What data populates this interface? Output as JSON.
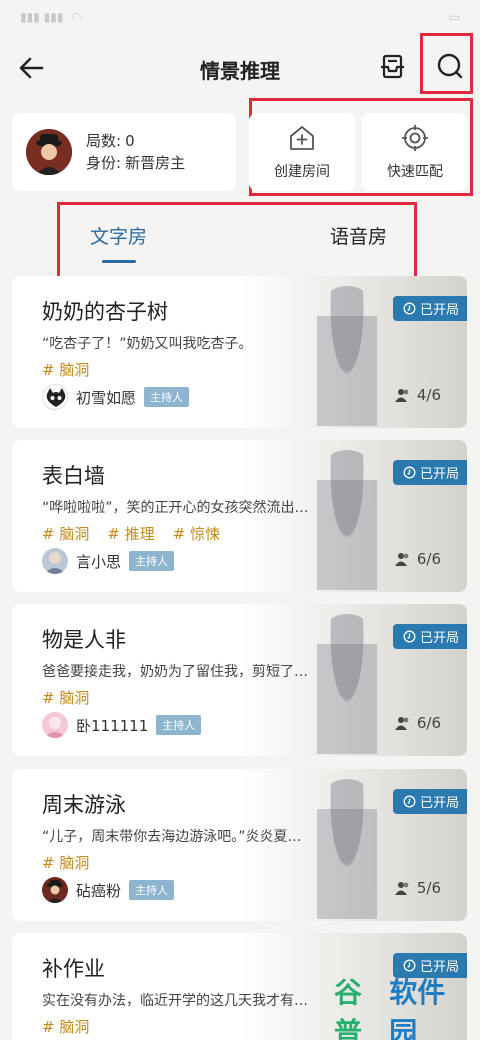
{
  "nav": {
    "title": "情景推理"
  },
  "profile": {
    "games_label": "局数:",
    "games_value": "0",
    "identity_label": "身份:",
    "identity_value": "新晋房主"
  },
  "actions": {
    "create_room": "创建房间",
    "quick_match": "快速匹配"
  },
  "tabs": [
    {
      "label": "文字房",
      "active": true
    },
    {
      "label": "语音房",
      "active": false
    }
  ],
  "rooms": [
    {
      "title": "奶奶的杏子树",
      "desc": "“吃杏子了！”奶奶又叫我吃杏子。",
      "tags": [
        "# 脑洞"
      ],
      "host": "初雪如愿",
      "host_badge": "主持人",
      "status": "已开局",
      "players": "4/6"
    },
    {
      "title": "表白墙",
      "desc": "“哗啦啦啦”，笑的正开心的女孩突然流出…",
      "tags": [
        "# 脑洞",
        "# 推理",
        "# 惊悚"
      ],
      "host": "言小思",
      "host_badge": "主持人",
      "status": "已开局",
      "players": "6/6"
    },
    {
      "title": "物是人非",
      "desc": "爸爸要接走我，奶奶为了留住我，剪短了…",
      "tags": [
        "# 脑洞"
      ],
      "host": "卧111111",
      "host_badge": "主持人",
      "status": "已开局",
      "players": "6/6"
    },
    {
      "title": "周末游泳",
      "desc": "“儿子，周末带你去海边游泳吧。”炎炎夏…",
      "tags": [
        "# 脑洞"
      ],
      "host": "砧癌粉",
      "host_badge": "主持人",
      "status": "已开局",
      "players": "5/6"
    },
    {
      "title": "补作业",
      "desc": "实在没有办法，临近开学的这几天我才有…",
      "tags": [
        "# 脑洞"
      ],
      "host": "",
      "host_badge": "",
      "status": "已开局",
      "players": ""
    }
  ],
  "watermark": {
    "part1": "谷普",
    "part2": "软件园"
  },
  "colors": {
    "accent_blue": "#2a6aa0",
    "tag_orange": "#c48a1a",
    "highlight_red": "#e02a3b",
    "badge_blue": "#2a7ab0"
  }
}
